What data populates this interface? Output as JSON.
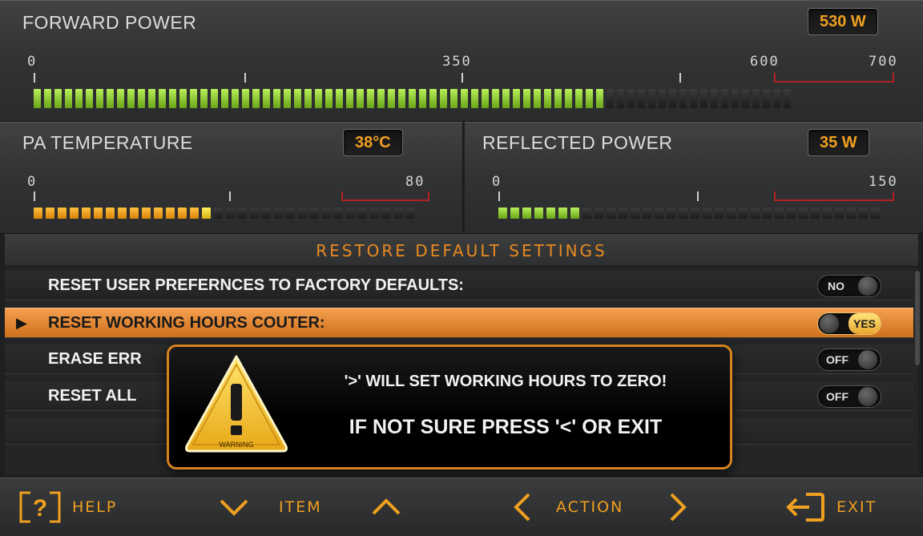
{
  "forward_power": {
    "title": "FORWARD POWER",
    "readout": "530 W",
    "scale_labels": [
      "0",
      "350",
      "600",
      "700"
    ],
    "level_fraction": 0.76
  },
  "pa_temperature": {
    "title": "PA TEMPERATURE",
    "readout": "38°C",
    "scale_labels": [
      "0",
      "80"
    ],
    "level_fraction": 0.47
  },
  "reflected_power": {
    "title": "REFLECTED POWER",
    "readout": "35 W",
    "scale_labels": [
      "0",
      "150"
    ],
    "level_fraction": 0.23
  },
  "restore": {
    "header": "RESTORE DEFAULT SETTINGS",
    "rows": [
      {
        "label": "RESET USER PREFERNCES TO FACTORY DEFAULTS:",
        "toggle": "NO",
        "state": "off",
        "selected": false
      },
      {
        "label": "RESET WORKING HOURS COUTER:",
        "toggle": "YES",
        "state": "on",
        "selected": true
      },
      {
        "label": "ERASE ERR",
        "toggle": "OFF",
        "state": "off",
        "selected": false
      },
      {
        "label": "RESET ALL",
        "toggle": "OFF",
        "state": "off",
        "selected": false
      }
    ]
  },
  "dialog": {
    "line1": "'>' WILL SET WORKING HOURS TO ZERO!",
    "line2": "IF NOT SURE PRESS '<' OR EXIT",
    "icon_label": "WARNING"
  },
  "bottom_bar": {
    "help": "HELP",
    "item": "ITEM",
    "action": "ACTION",
    "exit": "EXIT"
  },
  "colors": {
    "accent": "#f0a020",
    "meter_green": "#8cd02a",
    "meter_orange": "#f0a020",
    "redzone": "#b12222"
  }
}
